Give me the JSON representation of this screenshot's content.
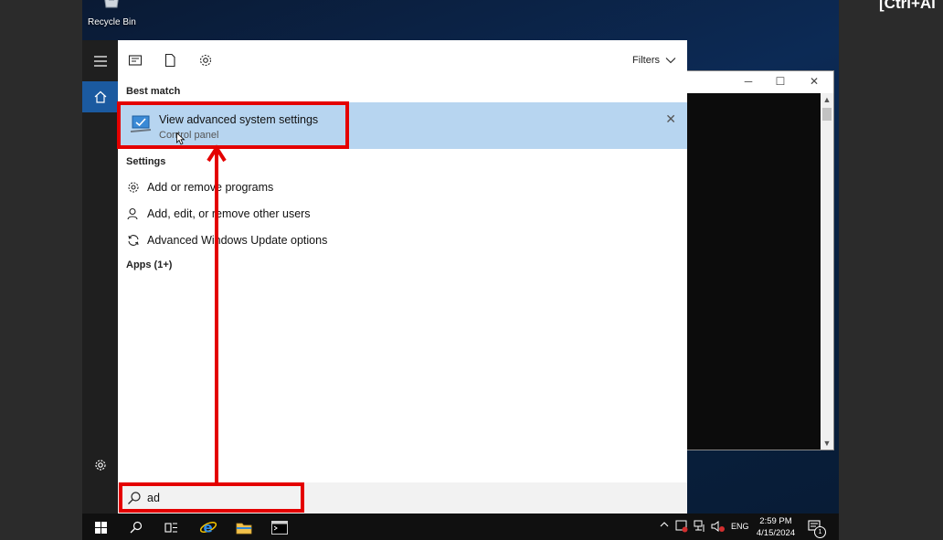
{
  "corner_hint": "[Ctrl+Al",
  "desktop": {
    "recycle_bin_label": "Recycle Bin"
  },
  "start_menu": {
    "filters_label": "Filters",
    "best_match_heading": "Best match",
    "best_match": {
      "title": "View advanced system settings",
      "subtitle": "Control panel",
      "icon": "system-settings-icon"
    },
    "settings_heading": "Settings",
    "settings_items": [
      {
        "label": "Add or remove programs",
        "icon": "gear-icon"
      },
      {
        "label": "Add, edit, or remove other users",
        "icon": "user-icon"
      },
      {
        "label": "Advanced Windows Update options",
        "icon": "refresh-icon"
      }
    ],
    "apps_heading": "Apps (1+)",
    "search_query": "ad"
  },
  "taskbar": {
    "language": "ENG",
    "time": "2:59 PM",
    "date": "4/15/2024",
    "notification_count": "1"
  },
  "colors": {
    "highlight": "#b7d5f0",
    "annotation_red": "#e40000",
    "rail_active": "#1b5aa0"
  }
}
